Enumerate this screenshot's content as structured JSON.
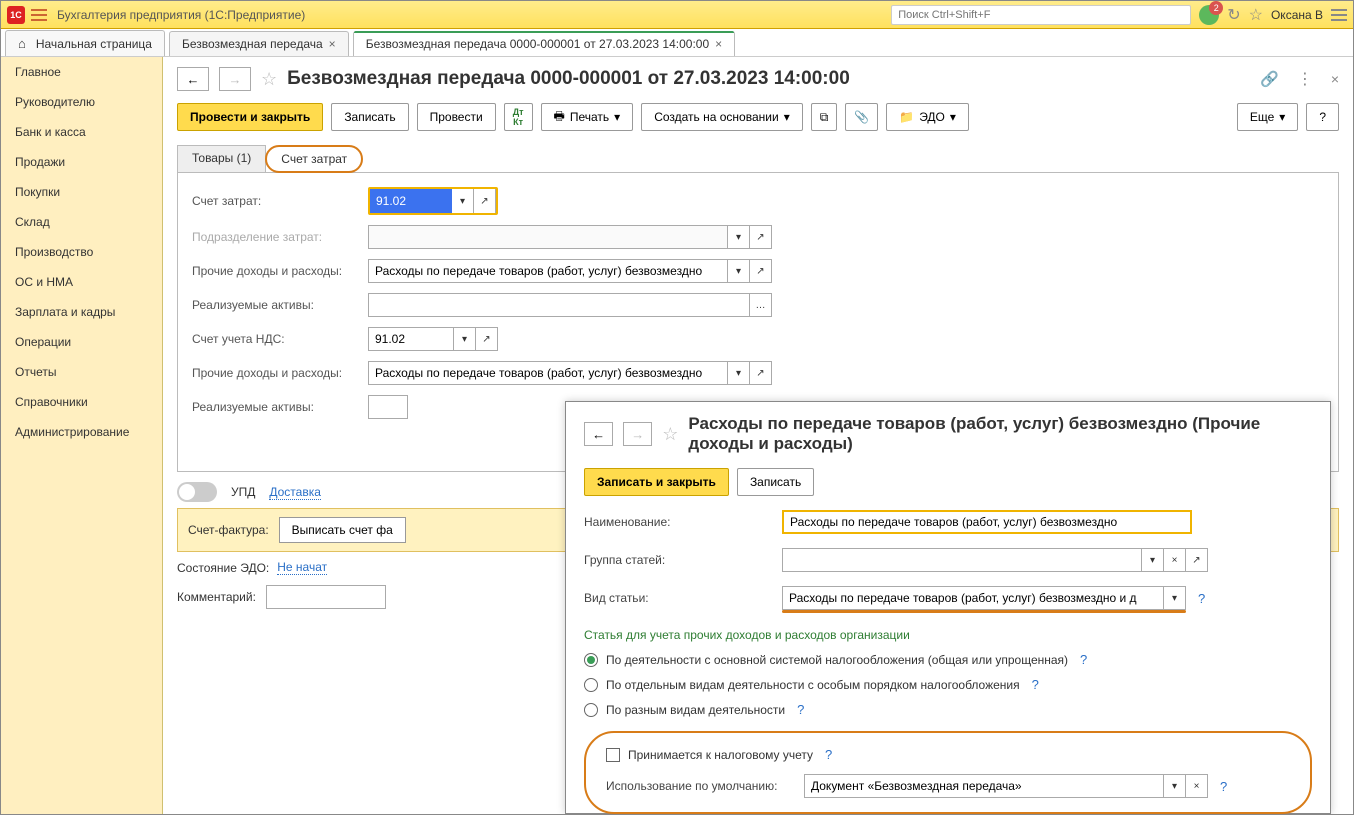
{
  "titlebar": {
    "app_title": "Бухгалтерия предприятия  (1С:Предприятие)",
    "search_placeholder": "Поиск Ctrl+Shift+F",
    "notifications_count": "2",
    "user_name": "Оксана В"
  },
  "tabs": {
    "home": "Начальная страница",
    "t1": "Безвозмездная передача",
    "t2": "Безвозмездная передача 0000-000001 от 27.03.2023 14:00:00"
  },
  "sidebar": {
    "items": [
      "Главное",
      "Руководителю",
      "Банк и касса",
      "Продажи",
      "Покупки",
      "Склад",
      "Производство",
      "ОС и НМА",
      "Зарплата и кадры",
      "Операции",
      "Отчеты",
      "Справочники",
      "Администрирование"
    ]
  },
  "doc": {
    "title": "Безвозмездная передача 0000-000001 от 27.03.2023 14:00:00",
    "btn_post_close": "Провести и закрыть",
    "btn_write": "Записать",
    "btn_post": "Провести",
    "btn_print": "Печать",
    "btn_create_basis": "Создать на основании",
    "btn_edo": "ЭДО",
    "btn_more": "Еще",
    "btn_help": "?",
    "tab_goods": "Товары (1)",
    "tab_accounts": "Счет затрат",
    "labels": {
      "acc_cost": "Счет затрат:",
      "subdiv": "Подразделение затрат:",
      "other": "Прочие доходы и расходы:",
      "assets": "Реализуемые активы:",
      "acc_vat": "Счет учета НДС:",
      "other2": "Прочие доходы и расходы:",
      "assets2": "Реализуемые активы:"
    },
    "values": {
      "acc_cost": "91.02",
      "other": "Расходы по передаче товаров (работ, услуг) безвозмездно",
      "acc_vat": "91.02",
      "other2": "Расходы по передаче товаров (работ, услуг) безвозмездно"
    },
    "upd": "УПД",
    "delivery": "Доставка",
    "sf_label": "Счет-фактура:",
    "sf_btn": "Выписать счет фа",
    "edo_state_lbl": "Состояние ЭДО:",
    "edo_state_val": "Не начат",
    "comment_lbl": "Комментарий:"
  },
  "popup": {
    "title": "Расходы по передаче товаров (работ, услуг) безвозмездно (Прочие доходы и расходы)",
    "btn_write_close": "Записать и закрыть",
    "btn_write": "Записать",
    "lbl_name": "Наименование:",
    "val_name": "Расходы по передаче товаров (работ, услуг) безвозмездно",
    "lbl_group": "Группа статей:",
    "lbl_kind": "Вид статьи:",
    "val_kind": "Расходы по передаче товаров (работ, услуг) безвозмездно и д",
    "section": "Статья для учета прочих доходов и расходов организации",
    "radio1": "По деятельности с основной системой налогообложения (общая или упрощенная)",
    "radio2": "По отдельным видам деятельности с особым порядком налогообложения",
    "radio3": "По разным видам деятельности",
    "cb_tax": "Принимается к налоговому учету",
    "lbl_default": "Использование по умолчанию:",
    "val_default": "Документ «Безвозмездная передача»"
  }
}
